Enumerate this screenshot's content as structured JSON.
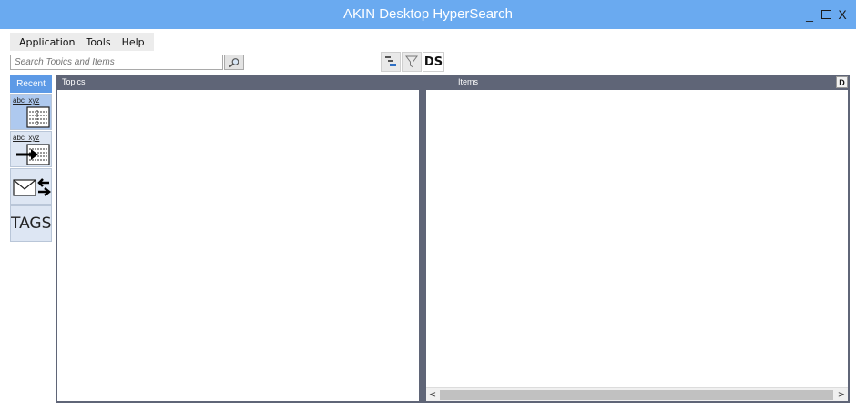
{
  "window": {
    "title": "AKIN Desktop HyperSearch",
    "minimize_label": "_",
    "close_label": "X"
  },
  "menu": {
    "items": [
      "Application",
      "Tools",
      "Help"
    ]
  },
  "search": {
    "placeholder": "Search Topics and Items"
  },
  "toolbar": {
    "ds_label": "DS"
  },
  "sidebar": {
    "recent_label": "Recent",
    "buttons": [
      {
        "label": "abc_xyz",
        "icon": "note-card-icon"
      },
      {
        "label": "abc_xyz",
        "icon": "note-card-arrow-icon"
      },
      {
        "label": "",
        "icon": "mail-exchange-icon"
      },
      {
        "label": "TAGS",
        "icon": ""
      }
    ]
  },
  "panels": {
    "topics": {
      "header": "Topics"
    },
    "items": {
      "header": "Items",
      "d_button": "D"
    }
  },
  "scrollbar": {
    "left_arrow": "<",
    "right_arrow": ">"
  },
  "colors": {
    "titlebar": "#6aaaf0",
    "panel_header": "#5f6577",
    "recent_tab": "#5d9ae6",
    "active_button": "#aec9ef"
  }
}
